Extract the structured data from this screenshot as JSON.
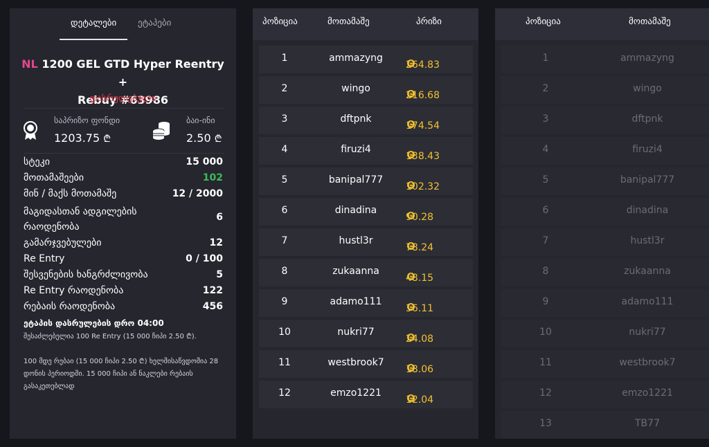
{
  "left": {
    "tabs": [
      "დეტალები",
      "ეტაპები"
    ],
    "title_prefix": "NL",
    "title_line1": "1200 GEL GTD Hyper Reentry +",
    "title_line2": "Rebuy #63986",
    "status": "დასრულებული",
    "prize_pool_label": "საპრიზო ფონდი",
    "prize_pool_value": "1203.75",
    "buyin_label": "ბაი-ინი",
    "buyin_value": "2.50",
    "currency_symbol": "₾",
    "rows": [
      {
        "k": "სტეკი",
        "v": "15 000"
      },
      {
        "k": "მოთამაშეები",
        "v": "102"
      },
      {
        "k": "მინ / მაქს მოთამაშე",
        "v": "12 / 2000"
      },
      {
        "k": "მაგიდასთან ადგილების რაოდენობა",
        "v": "6"
      },
      {
        "k": "გამარჯვებულები",
        "v": "12"
      },
      {
        "k": "Re Entry",
        "v": "0 / 100"
      },
      {
        "k": "შესვენების ხანგრძლივობა",
        "v": "5"
      },
      {
        "k": "Re Entry რაოდენობა",
        "v": "122"
      },
      {
        "k": "რებაის რაოდენობა",
        "v": "456"
      }
    ],
    "note_bold": "ეტაპის დასრულების დრო 04:00",
    "note1": "შესაძლებელია 100 Re Entry (15 000 ჩიპი 2.50 ₾).",
    "note2": "100 მდე რებაი (15 000 ჩიპი 2.50 ₾) ხელმისაწვდომია 28 დონის პერიოდში. 15 000 ჩიპი ან ნაკლები რებაის გასაკეთებლად"
  },
  "middle": {
    "headers": [
      "პოზიცია",
      "მოთამაშე",
      "პრიზი"
    ],
    "rows": [
      {
        "pos": "1",
        "name": "ammazyng",
        "prize": "264.83"
      },
      {
        "pos": "2",
        "name": "wingo",
        "prize": "216.68"
      },
      {
        "pos": "3",
        "name": "dftpnk",
        "prize": "174.54"
      },
      {
        "pos": "4",
        "name": "firuzi4",
        "prize": "138.43"
      },
      {
        "pos": "5",
        "name": "banipal777",
        "prize": "102.32"
      },
      {
        "pos": "6",
        "name": "dinadina",
        "prize": "90.28"
      },
      {
        "pos": "7",
        "name": "hustl3r",
        "prize": "78.24"
      },
      {
        "pos": "8",
        "name": "zukaanna",
        "prize": "48.15"
      },
      {
        "pos": "9",
        "name": "adamo111",
        "prize": "36.11"
      },
      {
        "pos": "10",
        "name": "nukri77",
        "prize": "24.08"
      },
      {
        "pos": "11",
        "name": "westbrook7",
        "prize": "18.06"
      },
      {
        "pos": "12",
        "name": "emzo1221",
        "prize": "12.04"
      }
    ]
  },
  "right": {
    "headers": [
      "პოზიცია",
      "მოთამაშე"
    ],
    "rows": [
      {
        "pos": "1",
        "name": "ammazyng"
      },
      {
        "pos": "2",
        "name": "wingo"
      },
      {
        "pos": "3",
        "name": "dftpnk"
      },
      {
        "pos": "4",
        "name": "firuzi4"
      },
      {
        "pos": "5",
        "name": "banipal777"
      },
      {
        "pos": "6",
        "name": "dinadina"
      },
      {
        "pos": "7",
        "name": "hustl3r"
      },
      {
        "pos": "8",
        "name": "zukaanna"
      },
      {
        "pos": "9",
        "name": "adamo111"
      },
      {
        "pos": "10",
        "name": "nukri77"
      },
      {
        "pos": "11",
        "name": "westbrook7"
      },
      {
        "pos": "12",
        "name": "emzo1221"
      },
      {
        "pos": "13",
        "name": "TB77"
      }
    ]
  }
}
